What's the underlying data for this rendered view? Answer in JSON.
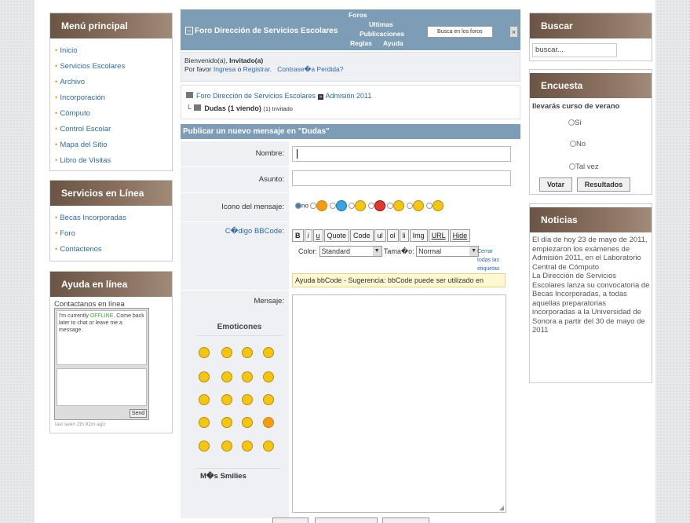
{
  "menu": {
    "title": "Menú principal",
    "items": [
      "Inicio",
      "Servicios Escolares",
      "Archivo",
      "Incorporación",
      "Cómputo",
      "Control Escolar",
      "Mapa del Sitio",
      "Libro de Visitas"
    ]
  },
  "services": {
    "title": "Servicios en Línea",
    "items": [
      "Becas Incorporadas",
      "Foro",
      "Contactenos"
    ]
  },
  "help": {
    "title": "Ayuda en línea",
    "contact_label": "Contactanos en línea",
    "chat_msg_a": "I'm currently ",
    "chat_status": "OFFLINE",
    "chat_msg_b": ". Come back later to chat or leave me a message.",
    "send_label": "Send",
    "last_seen": "last seen 2th 92m ago"
  },
  "forum": {
    "title": "Foro Dirección de Servicios Escolares",
    "nav": {
      "foros": "Foros",
      "ultimas": "Ultimas",
      "publicaciones": "Publicaciones",
      "reglas": "Reglas",
      "ayuda": "Ayuda"
    },
    "search_placeholder": "Busca en los foros",
    "search_go": "»",
    "welcome": "Bienvenido(a), ",
    "user": "Invitado(a)",
    "login_prefix": "Por favor ",
    "login_link": "Ingresa",
    "login_or": " o ",
    "register_link": "Registrar.",
    "lost_pw": "Contrase�a Perdida?",
    "crumb1": "Foro Dirección de Servicios Escolares",
    "crumb_sep": "»",
    "crumb2": "Admisión 2011",
    "sub_title": "Dudas (1 viendo)",
    "sub_viewers": "(1) Invitado"
  },
  "post": {
    "header": "Publicar un nuevo mensaje en \"Dudas\"",
    "name_label": "Nombre:",
    "subject_label": "Asunto:",
    "icon_label": "Icono del mensaje:",
    "icon_no": "no",
    "bbcode_label": "C�digo BBCode:",
    "bb_buttons": [
      "B",
      "i",
      "u",
      "Quote",
      "Code",
      "ul",
      "ol",
      "li",
      "Img",
      "URL",
      "Hide"
    ],
    "color_label": "Color:",
    "color_value": "Standard",
    "size_label": "Tama�o:",
    "size_value": "Normal",
    "close_tags": "Cerrar todas las etiquetas",
    "bb_help": "Ayuda bbCode - Sugerencia: bbCode puede ser utilizado en",
    "message_label": "Mensaje:",
    "emoticons_title": "Emoticones",
    "more_smilies": "M�s Smilies"
  },
  "search": {
    "title": "Buscar",
    "value": "buscar..."
  },
  "poll": {
    "title": "Encuesta",
    "question": "llevarás curso de verano",
    "options": [
      "Si",
      "No",
      "Tal vez"
    ],
    "vote": "Votar",
    "results": "Resultados"
  },
  "news": {
    "title": "Noticias",
    "text1": "El día de hoy 23 de mayo de 2011, empiezaron los exámenes de Admisión 2011, en el Laboratorio Central de Cómputo",
    "text2": "La Dirección de Servicios Escolares lanza su convocatoria de Becas Incorporadas, a todas aquellas preparatorias incorporadas a la Universidad de Sonora a partir del 30 de mayo de 2011"
  }
}
